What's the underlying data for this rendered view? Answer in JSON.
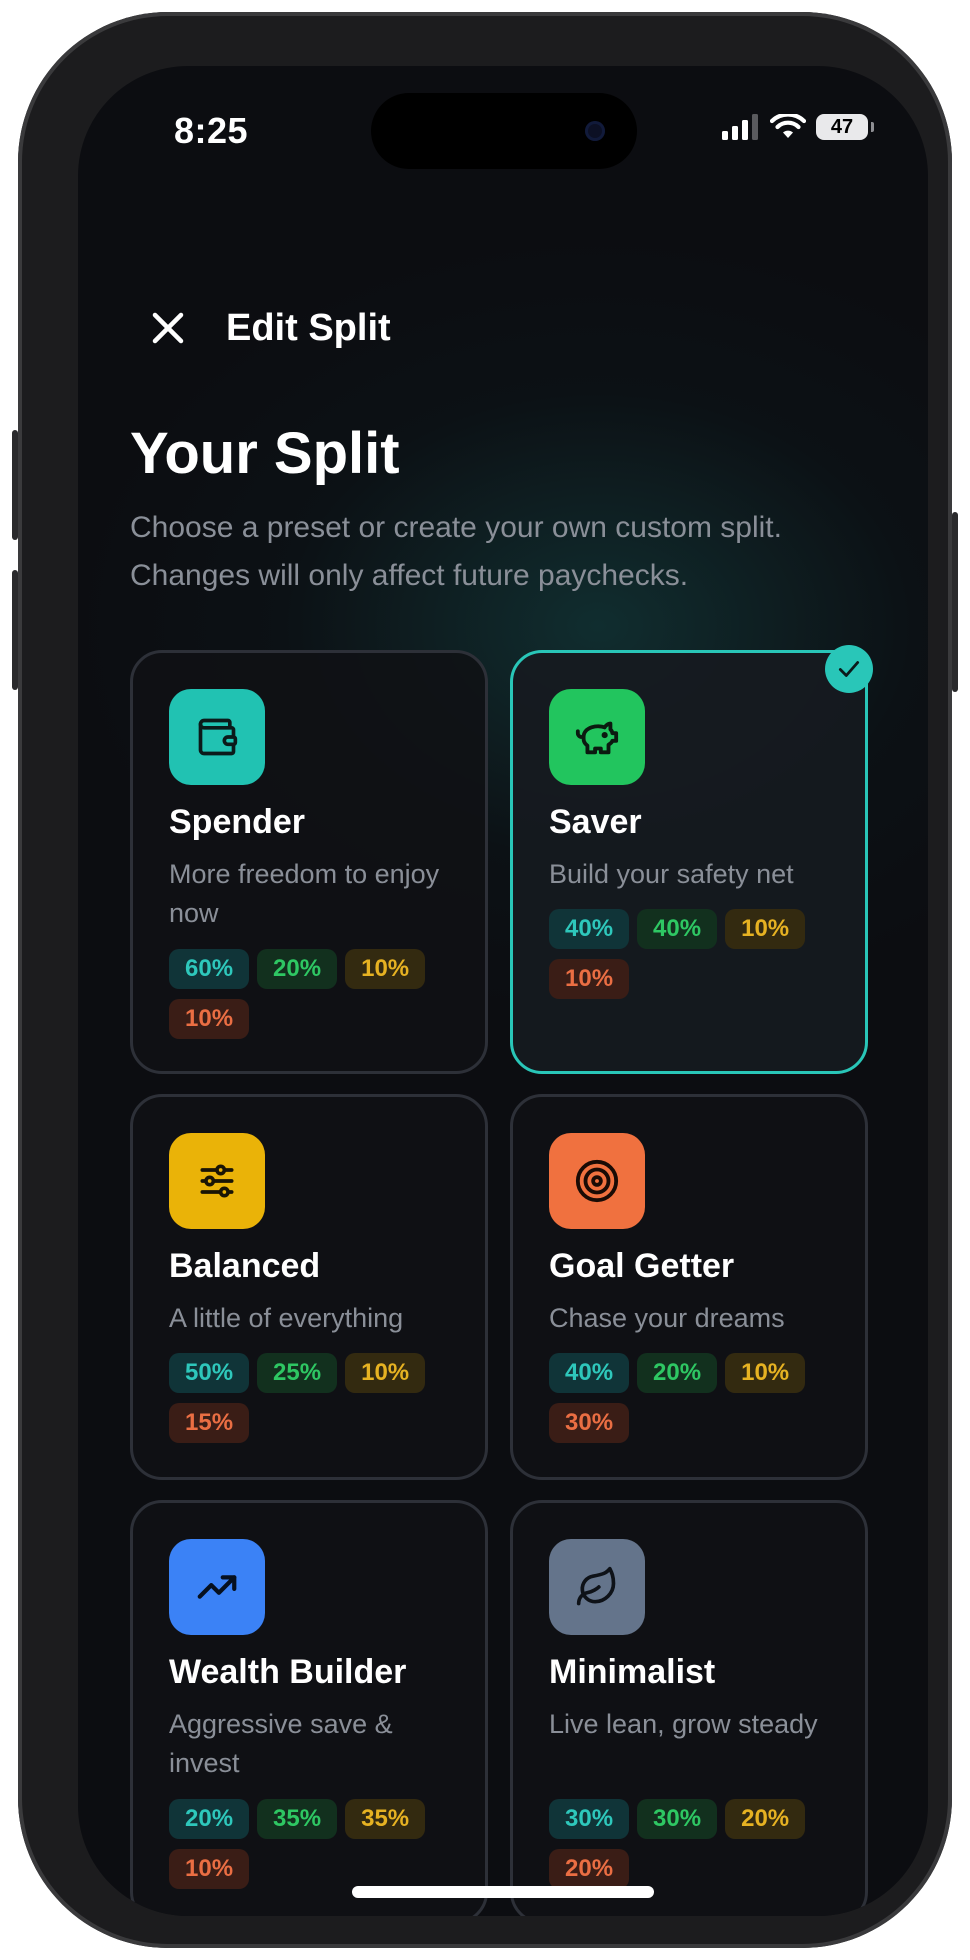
{
  "status_bar": {
    "time": "8:25",
    "battery": "47",
    "icons": [
      "cellular-signal-icon",
      "wifi-icon",
      "battery-icon"
    ]
  },
  "nav": {
    "title": "Edit Split",
    "close_icon": "close-icon"
  },
  "heading": "Your Split",
  "subtitle": "Choose a preset or create your own custom split. Changes will only affect future paychecks.",
  "colors": {
    "accent": "#29c6b8",
    "chip_teal": "#2ec7bb",
    "chip_green": "#2ec763",
    "chip_yellow": "#e6b222",
    "chip_orange": "#ea6e43"
  },
  "presets": [
    {
      "title": "Spender",
      "description": "More freedom to enjoy now",
      "icon": "wallet-icon",
      "icon_color": "#21c2b2",
      "selected": false,
      "splits": [
        "60%",
        "20%",
        "10%",
        "10%"
      ]
    },
    {
      "title": "Saver",
      "description": "Build your safety net",
      "icon": "piggy-bank-icon",
      "icon_color": "#22c55e",
      "selected": true,
      "splits": [
        "40%",
        "40%",
        "10%",
        "10%"
      ]
    },
    {
      "title": "Balanced",
      "description": "A little of everything",
      "icon": "sliders-icon",
      "icon_color": "#eab308",
      "selected": false,
      "splits": [
        "50%",
        "25%",
        "10%",
        "15%"
      ]
    },
    {
      "title": "Goal Getter",
      "description": "Chase your dreams",
      "icon": "target-icon",
      "icon_color": "#f0713f",
      "selected": false,
      "splits": [
        "40%",
        "20%",
        "10%",
        "30%"
      ]
    },
    {
      "title": "Wealth Builder",
      "description": "Aggressive save & invest",
      "icon": "trending-up-icon",
      "icon_color": "#3b82f6",
      "selected": false,
      "splits": [
        "20%",
        "35%",
        "35%",
        "10%"
      ]
    },
    {
      "title": "Minimalist",
      "description": "Live lean, grow steady",
      "icon": "leaf-icon",
      "icon_color": "#64748b",
      "selected": false,
      "splits": [
        "30%",
        "30%",
        "20%",
        "20%"
      ]
    }
  ]
}
